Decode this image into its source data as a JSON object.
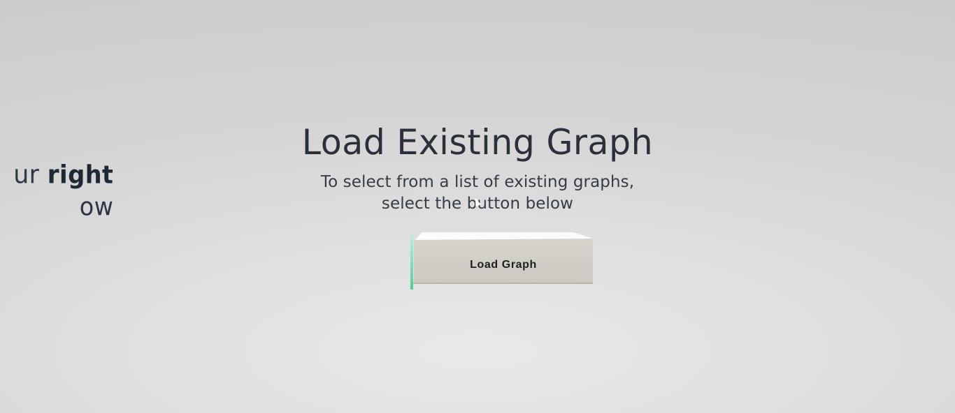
{
  "side_panel": {
    "line1_light": "ur ",
    "line1_bold": "right",
    "line2": "ow"
  },
  "main": {
    "title": "Load Existing Graph",
    "subtitle_line1": "To select from a list of existing graphs,",
    "subtitle_line2": "select the button below"
  },
  "button": {
    "label": "Load Graph"
  },
  "colors": {
    "text": "#2a313b",
    "button_face": "#d1cec8",
    "button_edge_accent": "#4fcf97",
    "background": "#d8d8d8"
  }
}
